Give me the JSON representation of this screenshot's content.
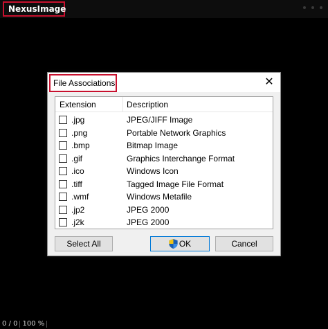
{
  "app": {
    "title": "NexusImage"
  },
  "status": {
    "count": "0 / 0",
    "zoom": "100 %"
  },
  "dialog": {
    "title": "File Associations",
    "close_glyph": "✕",
    "columns": {
      "extension": "Extension",
      "description": "Description"
    },
    "rows": [
      {
        "ext": ".jpg",
        "desc": "JPEG/JIFF Image"
      },
      {
        "ext": ".png",
        "desc": "Portable Network Graphics"
      },
      {
        "ext": ".bmp",
        "desc": "Bitmap Image"
      },
      {
        "ext": ".gif",
        "desc": "Graphics Interchange Format"
      },
      {
        "ext": ".ico",
        "desc": "Windows Icon"
      },
      {
        "ext": ".tiff",
        "desc": "Tagged Image File Format"
      },
      {
        "ext": ".wmf",
        "desc": "Windows Metafile"
      },
      {
        "ext": ".jp2",
        "desc": "JPEG 2000"
      },
      {
        "ext": ".j2k",
        "desc": "JPEG 2000"
      }
    ],
    "buttons": {
      "select_all": "Select All",
      "ok": "OK",
      "cancel": "Cancel"
    }
  },
  "colors": {
    "highlight": "#c8102e",
    "background": "#000000",
    "dialog_bg": "#f0f0f0",
    "ok_border": "#0078d7"
  },
  "icons": {
    "close": "close-icon",
    "ok": "uac-shield-icon"
  }
}
